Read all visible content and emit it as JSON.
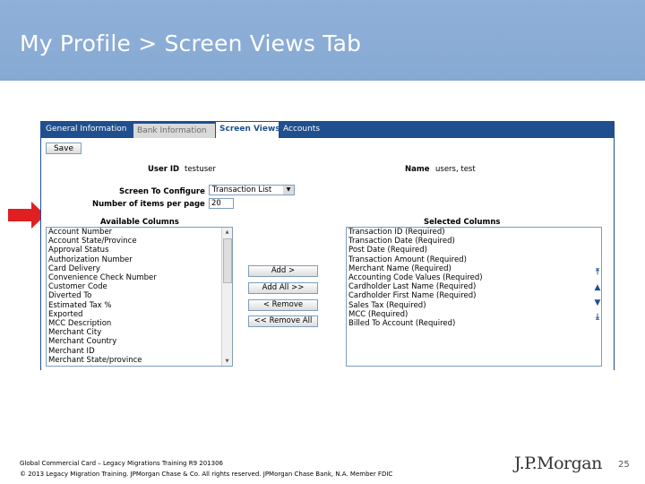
{
  "slide": {
    "title": "My Profile > Screen Views Tab",
    "footer_line1": "Global Commercial Card – Legacy Migrations Training R9 201306",
    "footer_line2": "© 2013 Legacy Migration Training. JPMorgan Chase & Co. All rights reserved. JPMorgan Chase Bank, N.A. Member FDIC",
    "brand": "J.P.Morgan",
    "page_number": "25",
    "colors": {
      "banner": "#8fb0d8",
      "tab_bar": "#1f4f8f",
      "arrow": "#e02020"
    }
  },
  "app": {
    "tabs": [
      {
        "label": "General Information"
      },
      {
        "label": "Bank Information"
      },
      {
        "label": "Screen Views"
      },
      {
        "label": "Accounts"
      }
    ],
    "active_tab": "Screen Views",
    "save_label": "Save",
    "user_id_label": "User ID",
    "user_id_value": "testuser",
    "name_label": "Name",
    "name_value": "users, test",
    "screen_label": "Screen To Configure",
    "screen_value": "Transaction List",
    "items_label": "Number of items per page",
    "items_value": "20",
    "available_label": "Available Columns",
    "selected_label": "Selected Columns",
    "available_columns": [
      "Account Number",
      "Account State/Province",
      "Approval Status",
      "Authorization Number",
      "Card Delivery",
      "Convenience Check Number",
      "Customer Code",
      "Diverted To",
      "Estimated Tax %",
      "Exported",
      "MCC Description",
      "Merchant City",
      "Merchant Country",
      "Merchant ID",
      "Merchant State/province"
    ],
    "selected_columns": [
      "Transaction ID (Required)",
      "Transaction Date (Required)",
      "Post Date (Required)",
      "Transaction Amount (Required)",
      "Merchant Name (Required)",
      "Accounting Code Values (Required)",
      "Cardholder Last Name (Required)",
      "Cardholder First Name (Required)",
      "Sales Tax (Required)",
      "MCC (Required)",
      "Billed To Account (Required)"
    ],
    "buttons": {
      "add": "Add >",
      "add_all": "Add All >>",
      "remove": "< Remove",
      "remove_all": "<< Remove All"
    },
    "icons": [
      "move-top-icon",
      "move-up-icon",
      "move-down-icon",
      "move-bottom-icon"
    ]
  }
}
